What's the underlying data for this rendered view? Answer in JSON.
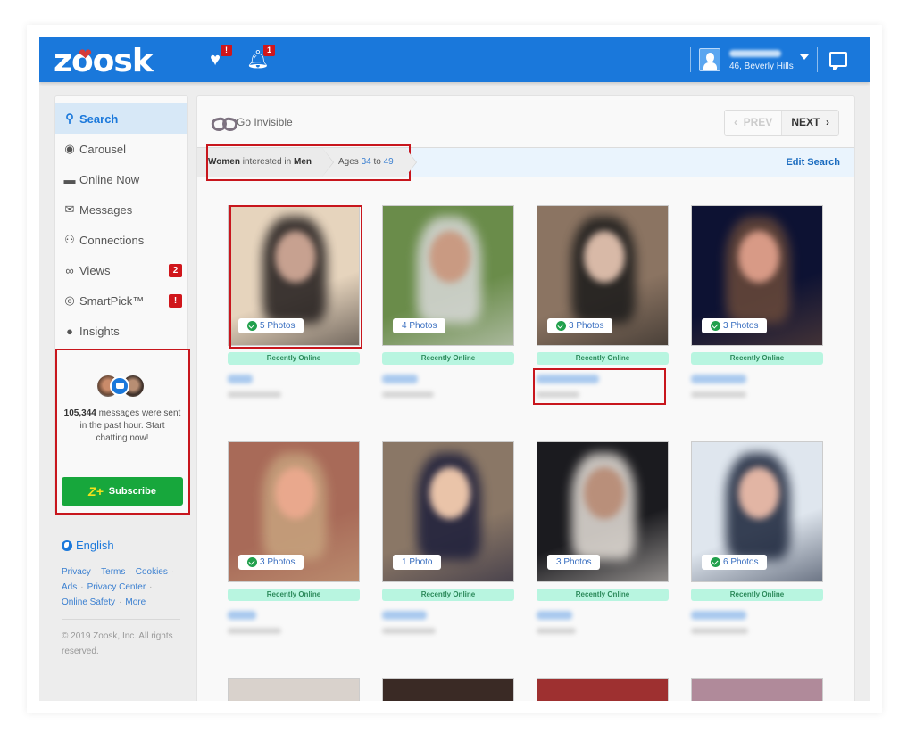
{
  "header": {
    "logo": "zoosk",
    "notifications": [
      {
        "icon": "heart-check-icon",
        "badge": "!"
      },
      {
        "icon": "bell-icon",
        "badge": "1"
      }
    ],
    "user": {
      "location": "46, Beverly Hills"
    }
  },
  "sidebar": {
    "items": [
      {
        "label": "Search",
        "icon": "search-icon",
        "active": true
      },
      {
        "label": "Carousel",
        "icon": "carousel-icon"
      },
      {
        "label": "Online Now",
        "icon": "online-now-icon"
      },
      {
        "label": "Messages",
        "icon": "envelope-icon"
      },
      {
        "label": "Connections",
        "icon": "connections-icon"
      },
      {
        "label": "Views",
        "icon": "glasses-icon",
        "badge": "2"
      },
      {
        "label": "SmartPick™",
        "icon": "target-icon",
        "badge": "!"
      },
      {
        "label": "Insights",
        "icon": "insights-icon"
      }
    ],
    "promo": {
      "count": "105,344",
      "text": " messages were sent in the past hour. Start chatting now!",
      "button": "Subscribe",
      "button_icon": "Z+"
    },
    "footer": {
      "language": "English",
      "links": [
        "Privacy",
        "Terms",
        "Cookies",
        "Ads",
        "Privacy Center",
        "Online Safety",
        "More"
      ],
      "copyright": "© 2019 Zoosk, Inc. All rights reserved."
    }
  },
  "main": {
    "go_invisible": "Go Invisible",
    "pager": {
      "prev": "PREV",
      "next": "NEXT"
    },
    "filters": {
      "gender_a": "Women",
      "interested": " interested in ",
      "gender_b": "Men",
      "ages_label": "Ages ",
      "age_min": "34",
      "to": " to ",
      "age_max": "49"
    },
    "edit_search": "Edit Search",
    "status_label": "Recently Online",
    "profiles": [
      {
        "photos": "5 Photos",
        "verified": true,
        "bg": "#e6d4bd",
        "face": "#c7a190",
        "hair": "#1f1a1a"
      },
      {
        "photos": "4 Photos",
        "verified": false,
        "bg": "#6a8c4a",
        "face": "#c99a82",
        "hair": "#d9d9d9"
      },
      {
        "photos": "3 Photos",
        "verified": true,
        "bg": "#8b7462",
        "face": "#d8b9a7",
        "hair": "#1a1a1a"
      },
      {
        "photos": "3 Photos",
        "verified": true,
        "bg": "#0d1233",
        "face": "#d89a86",
        "hair": "#6a4a3a"
      },
      {
        "photos": "3 Photos",
        "verified": true,
        "bg": "#a86a58",
        "face": "#e9a88d",
        "hair": "#c7a37e"
      },
      {
        "photos": "1 Photo",
        "verified": false,
        "bg": "#8a7766",
        "face": "#eac4a9",
        "hair": "#1b1d3a"
      },
      {
        "photos": "3 Photos",
        "verified": false,
        "bg": "#1b1b1f",
        "face": "#b98f7a",
        "hair": "#e7e1da"
      },
      {
        "photos": "6 Photos",
        "verified": true,
        "bg": "#dfe6ee",
        "face": "#e2b5a4",
        "hair": "#182238"
      }
    ],
    "next_row_colors": [
      "#d9d2cc",
      "#3a2a25",
      "#9e3030",
      "#b08a9a"
    ]
  },
  "colors": {
    "brand_blue": "#1a78db",
    "badge_red": "#d0161b",
    "subscribe_green": "#17a73c",
    "online_mint": "#b8f5e0",
    "annotation_red": "#c8161d"
  }
}
